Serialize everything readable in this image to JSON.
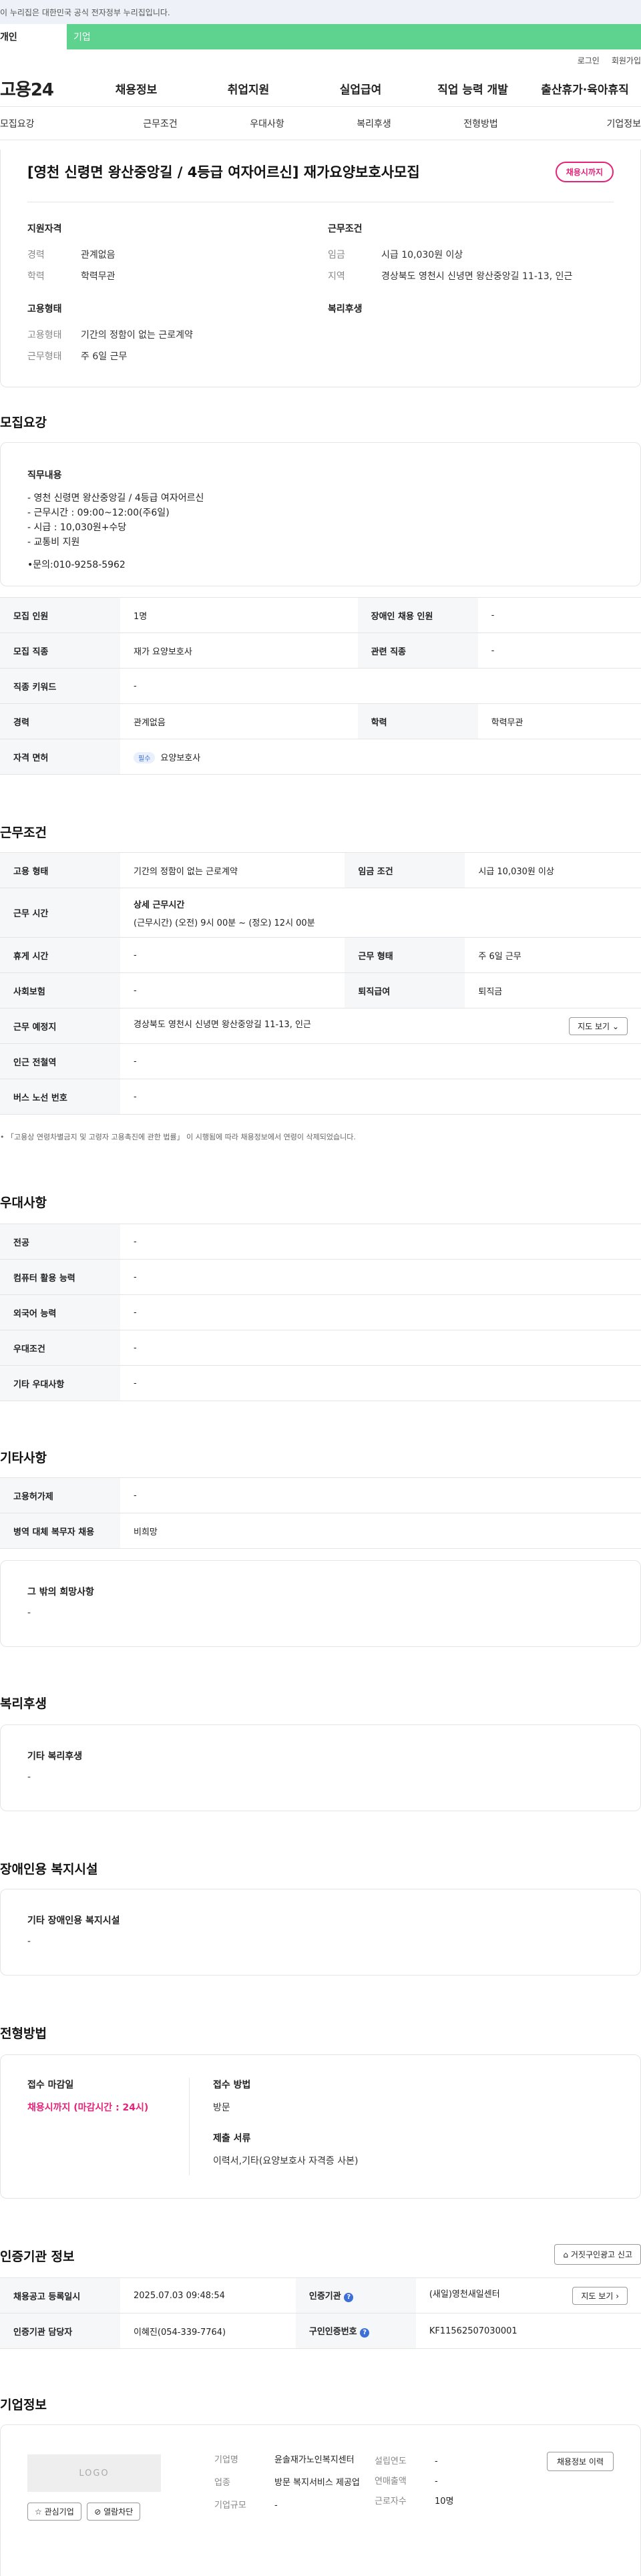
{
  "gov_notice": "이 누리집은 대한민국 공식 전자정부 누리집입니다.",
  "member_tabs": {
    "person": "개인",
    "company": "기업"
  },
  "util": {
    "login": "로그인",
    "join": "회원가입"
  },
  "logo": "고용24",
  "gnb": [
    "채용정보",
    "취업지원",
    "실업급여",
    "직업 능력 개발",
    "출산휴가·육아휴직"
  ],
  "lnb": [
    "모집요강",
    "근무조건",
    "우대사항",
    "복리후생",
    "전형방법",
    "기업정보"
  ],
  "summary": {
    "title": "[영천 신령면 왕산중앙길 / 4등급 여자어르신] 재가요양보호사모집",
    "badge": "채용시까지",
    "qual_heading": "지원자격",
    "career_label": "경력",
    "career_value": "관계없음",
    "edu_label": "학력",
    "edu_value": "학력무관",
    "emp_heading": "고용형태",
    "emptype_label": "고용형태",
    "emptype_value": "기간의 정함이 없는 근로계약",
    "worktype_label": "근무형태",
    "worktype_value": "주 6일 근무",
    "cond_heading": "근무조건",
    "wage_label": "임금",
    "wage_value": "시급 10,030원 이상",
    "region_label": "지역",
    "region_value": "경상북도 영천시 신녕면 왕산중앙길 11-13, 인근",
    "welfare_heading": "복리후생"
  },
  "recruit": {
    "title": "모집요강",
    "desc_heading": "직무내용",
    "desc_lines": [
      "- 영천 신령면 왕산중앙길 / 4등급 여자어르신",
      "- 근무시간 : 09:00~12:00(주6일)",
      "- 시급 : 10,030원+수당",
      "- 교통비 지원",
      "",
      "•문의:010-9258-5962"
    ],
    "rows": {
      "count_label": "모집 인원",
      "count_value": "1명",
      "disabled_label": "장애인 채용 인원",
      "disabled_value": "-",
      "job_label": "모집 직종",
      "job_value": "재가 요양보호사",
      "related_label": "관련 직종",
      "related_value": "-",
      "keyword_label": "직종 키워드",
      "keyword_value": "-",
      "career_label": "경력",
      "career_value": "관계없음",
      "edu_label": "학력",
      "edu_value": "학력무관",
      "license_label": "자격 면허",
      "license_tag": "필수",
      "license_value": "요양보호사"
    }
  },
  "work": {
    "title": "근무조건",
    "emp_label": "고용 형태",
    "emp_value": "기간의 정함이 없는 근로계약",
    "wage_label": "임금 조건",
    "wage_value": "시급 10,030원 이상",
    "time_label": "근무 시간",
    "time_head": "상세 근무시간",
    "time_value": "(근무시간) (오전) 9시 00분 ~ (정오) 12시 00분",
    "rest_label": "휴게 시간",
    "rest_value": "-",
    "worktype_label": "근무 형태",
    "worktype_value": "주 6일 근무",
    "insure_label": "사회보험",
    "insure_value": "-",
    "retire_label": "퇴직급여",
    "retire_value": "퇴직금",
    "place_label": "근무 예정지",
    "place_value": "경상북도 영천시 신녕면 왕산중앙길 11-13, 인근",
    "map_btn": "지도 보기",
    "subway_label": "인근 전철역",
    "subway_value": "-",
    "bus_label": "버스 노선 번호",
    "bus_value": "-",
    "note": "「고용상 연령차별금지 및 고령자 고용촉진에 관한 법률」 이 시행됨에 따라 채용정보에서 연령이 삭제되었습니다."
  },
  "pref": {
    "title": "우대사항",
    "rows": [
      {
        "label": "전공",
        "value": "-"
      },
      {
        "label": "컴퓨터 활용 능력",
        "value": "-"
      },
      {
        "label": "외국어 능력",
        "value": "-"
      },
      {
        "label": "우대조건",
        "value": "-"
      },
      {
        "label": "기타 우대사항",
        "value": "-"
      }
    ]
  },
  "etc": {
    "title": "기타사항",
    "rows": [
      {
        "label": "고용허가제",
        "value": "-"
      },
      {
        "label": "병역 대체 복무자 채용",
        "value": "비희망"
      }
    ],
    "hope_heading": "그 밖의 희망사항",
    "hope_value": "-"
  },
  "welfare": {
    "title": "복리후생",
    "heading": "기타 복리후생",
    "value": "-"
  },
  "disab": {
    "title": "장애인용 복지시설",
    "heading": "기타 장애인용 복지시설",
    "value": "-"
  },
  "select": {
    "title": "전형방법",
    "deadline_label": "접수 마감일",
    "deadline_value": "채용시까지 (마감시간 : 24시)",
    "method_label": "접수 방법",
    "method_value": "방문",
    "docs_label": "제출 서류",
    "docs_value": "이력서,기타(요양보호사 자격증 사본)"
  },
  "cert": {
    "title": "인증기관 정보",
    "report_btn": "거짓구인광고 신고",
    "reg_label": "채용공고 등록일시",
    "reg_value": "2025.07.03 09:48:54",
    "org_label": "인증기관",
    "org_value": "(새일)영천새일센터",
    "map_btn": "지도 보기",
    "mgr_label": "인증기관 담당자",
    "mgr_value": "이혜진(054-339-7764)",
    "no_label": "구인인증번호",
    "no_value": "KF11562507030001"
  },
  "company": {
    "title": "기업정보",
    "logo": "LOGO",
    "fav_btn": "관심기업",
    "block_btn": "열람차단",
    "name_label": "기업명",
    "name_value": "윤솔재가노인복지센터",
    "biz_label": "업종",
    "biz_value": "방문 복지서비스 제공업",
    "size_label": "기업규모",
    "size_value": "-",
    "year_label": "설립연도",
    "year_value": "-",
    "sales_label": "연매출액",
    "sales_value": "-",
    "emp_label": "근로자수",
    "emp_value": "10명",
    "history_btn": "채용정보 이력"
  }
}
